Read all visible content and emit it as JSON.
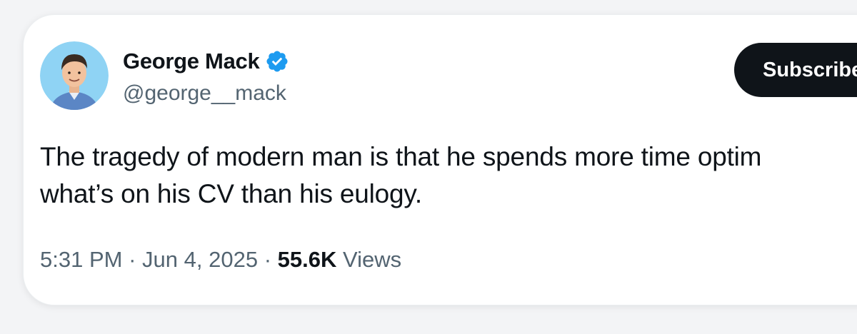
{
  "author": {
    "name": "George Mack",
    "handle": "@george__mack",
    "verified": true,
    "avatar": "avatar-illustration"
  },
  "subscribe_label": "Subscribe",
  "tweet": {
    "text": "The tragedy of modern man is that he spends more time optim\nwhat’s on his CV than his eulogy."
  },
  "meta": {
    "time": "5:31 PM",
    "separator": "·",
    "date": "Jun 4, 2025",
    "views_count": "55.6K",
    "views_label": "Views"
  },
  "colors": {
    "text_primary": "#0f1419",
    "text_secondary": "#536471",
    "verified_blue": "#1d9bf0",
    "button_bg": "#0f1419"
  }
}
